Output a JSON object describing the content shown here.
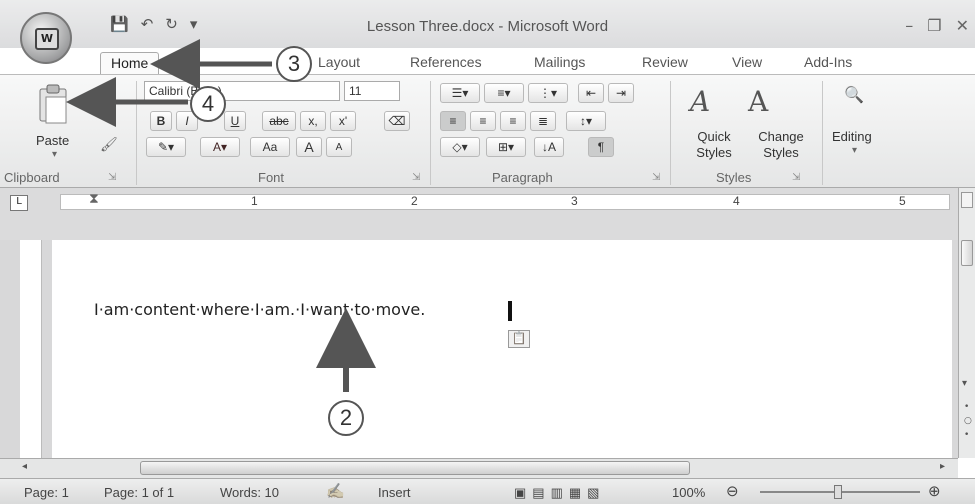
{
  "window": {
    "title": "Lesson Three.docx - Microsoft Word",
    "controls": [
      "–",
      "❐",
      "✕"
    ]
  },
  "quick_access": {
    "save_icon": "save-icon",
    "undo_label": "↶",
    "redo_label": "↻",
    "customize_label": "▾"
  },
  "tabs": [
    {
      "label": "Home",
      "active": true
    },
    {
      "label": "Layout",
      "active": false
    },
    {
      "label": "References",
      "active": false
    },
    {
      "label": "Mailings",
      "active": false
    },
    {
      "label": "Review",
      "active": false
    },
    {
      "label": "View",
      "active": false
    },
    {
      "label": "Add-Ins",
      "active": false
    }
  ],
  "ribbon": {
    "clipboard": {
      "paste_label": "Paste",
      "group_label": "Clipboard"
    },
    "font": {
      "font_name": "Calibri (Body)",
      "font_size": "11",
      "bold": "B",
      "italic": "I",
      "underline": "U",
      "strike": "abc",
      "subscript": "x,",
      "superscript": "x'",
      "change_case": "Aa",
      "grow": "A",
      "shrink": "A",
      "group_label": "Font"
    },
    "paragraph": {
      "show_marks": "¶",
      "sort": "↓A",
      "group_label": "Paragraph"
    },
    "styles": {
      "quick_styles_label": "Quick Styles",
      "change_styles_label": "Change Styles",
      "group_label": "Styles"
    },
    "editing": {
      "label": "Editing"
    }
  },
  "ruler": {
    "numbers": [
      "1",
      "2",
      "3",
      "4",
      "5"
    ]
  },
  "document": {
    "text": "I·am·content·where·I·am.·I·want·to·move.",
    "paste_options_icon": "paste-options-icon"
  },
  "status_bar": {
    "page": "Page: 1",
    "page_of": "Page: 1 of 1",
    "words": "Words: 10",
    "mode": "Insert",
    "zoom": "100%"
  },
  "callouts": {
    "two": "2",
    "three": "3",
    "four": "4"
  }
}
